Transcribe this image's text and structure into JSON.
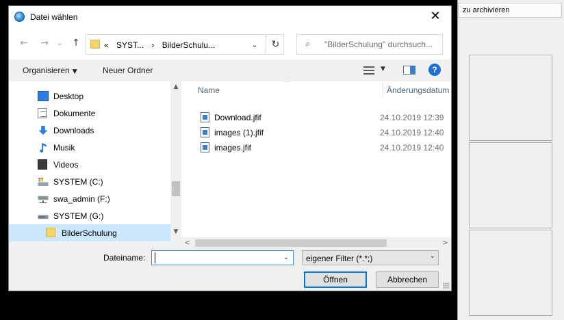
{
  "background_app": {
    "tab_label": "zu archivieren"
  },
  "dialog": {
    "title": "Datei wählen",
    "close_glyph": "✕",
    "nav": {
      "back_glyph": "←",
      "forward_glyph": "→",
      "recent_glyph": "⌄",
      "up_glyph": "↑"
    },
    "address": {
      "overflow": "«",
      "crumbs": [
        "SYST...",
        "›",
        "BilderSchulu..."
      ],
      "dropdown_glyph": "⌄",
      "refresh_glyph": "↻"
    },
    "search": {
      "icon": "search-icon",
      "glyph": "⌕",
      "placeholder": "\"BilderSchulung\" durchsuch..."
    },
    "toolbar": {
      "organize_label": "Organisieren",
      "organize_caret": "▼",
      "new_folder_label": "Neuer Ordner",
      "view_caret": "▼",
      "help_glyph": "?"
    },
    "tree": {
      "items": [
        {
          "label": "Desktop",
          "icon": "desktop-icon"
        },
        {
          "label": "Dokumente",
          "icon": "documents-icon"
        },
        {
          "label": "Downloads",
          "icon": "downloads-icon"
        },
        {
          "label": "Musik",
          "icon": "music-icon"
        },
        {
          "label": "Videos",
          "icon": "videos-icon"
        },
        {
          "label": "SYSTEM (C:)",
          "icon": "system-drive-icon"
        },
        {
          "label": "swa_admin (F:)",
          "icon": "network-drive-icon"
        },
        {
          "label": "SYSTEM (G:)",
          "icon": "drive-icon"
        },
        {
          "label": "BilderSchulung",
          "icon": "folder-icon",
          "selected": true
        }
      ],
      "scroll_up_glyph": "▲",
      "scroll_down_glyph": "▼"
    },
    "filelist": {
      "col_name": "Name",
      "col_date": "Änderungsdatum",
      "sort_glyph": "^",
      "files": [
        {
          "name": "Download.jfif",
          "date": "24.10.2019 12:39"
        },
        {
          "name": "images (1).jfif",
          "date": "24.10.2019 12:40"
        },
        {
          "name": "images.jfif",
          "date": "24.10.2019 12:40"
        }
      ],
      "hscroll_left_glyph": "<",
      "hscroll_right_glyph": ">"
    },
    "bottom": {
      "filename_label": "Dateiname:",
      "filename_value": "",
      "filename_dd_glyph": "⌄",
      "filter_value": "eigener Filter (*.*;)",
      "filter_dd_glyph": "⌄",
      "open_label": "Öffnen",
      "cancel_label": "Abbrechen"
    }
  },
  "colors": {
    "accent": "#0078d7",
    "selection": "#cce8ff",
    "folder": "#f6d36b"
  }
}
